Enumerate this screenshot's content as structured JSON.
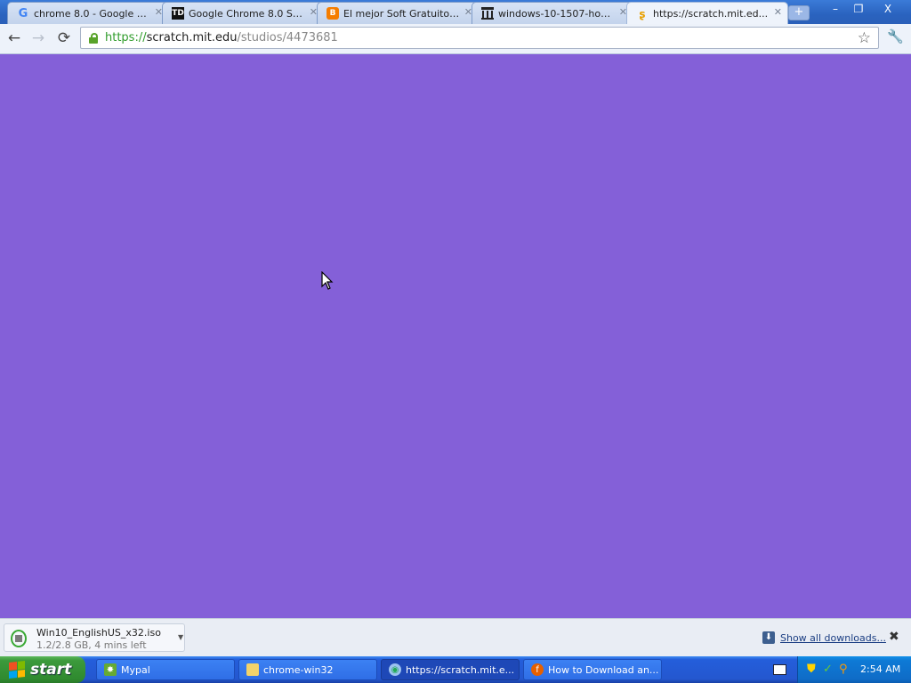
{
  "browser": {
    "tabs": [
      {
        "title": "chrome 8.0 - Google S...",
        "favicon": "google-icon",
        "active": false
      },
      {
        "title": "Google Chrome 8.0 Sta...",
        "favicon": "td-icon",
        "favicon_text": "TD",
        "active": false
      },
      {
        "title": "El mejor Soft Gratuito: ...",
        "favicon": "blogger-icon",
        "active": false
      },
      {
        "title": "windows-10-1507-hom...",
        "favicon": "archive-icon",
        "active": false
      },
      {
        "title": "https://scratch.mit.ed...",
        "favicon": "scratch-icon",
        "active": true
      }
    ],
    "new_tab_label": "+",
    "window_controls": {
      "minimize": "–",
      "restore": "❐",
      "close": "X"
    },
    "address": {
      "scheme": "https://",
      "host": "scratch.mit.edu",
      "path": "/studios/4473681"
    },
    "page_background": "#8460d8"
  },
  "downloads": {
    "item": {
      "filename": "Win10_EnglishUS_x32.iso",
      "status": "1.2/2.8 GB, 4 mins left"
    },
    "show_all_label": "Show all downloads...",
    "close_label": "✖"
  },
  "taskbar": {
    "start_label": "start",
    "tasks": [
      {
        "label": "Mypal",
        "icon": "mypal-icon",
        "active": false
      },
      {
        "label": "chrome-win32",
        "icon": "folder-icon",
        "active": false
      },
      {
        "label": "https://scratch.mit.e...",
        "icon": "chrome-icon",
        "active": true
      },
      {
        "label": "How to Download an...",
        "icon": "firefox-icon",
        "active": false
      }
    ],
    "clock": "2:54 AM"
  }
}
